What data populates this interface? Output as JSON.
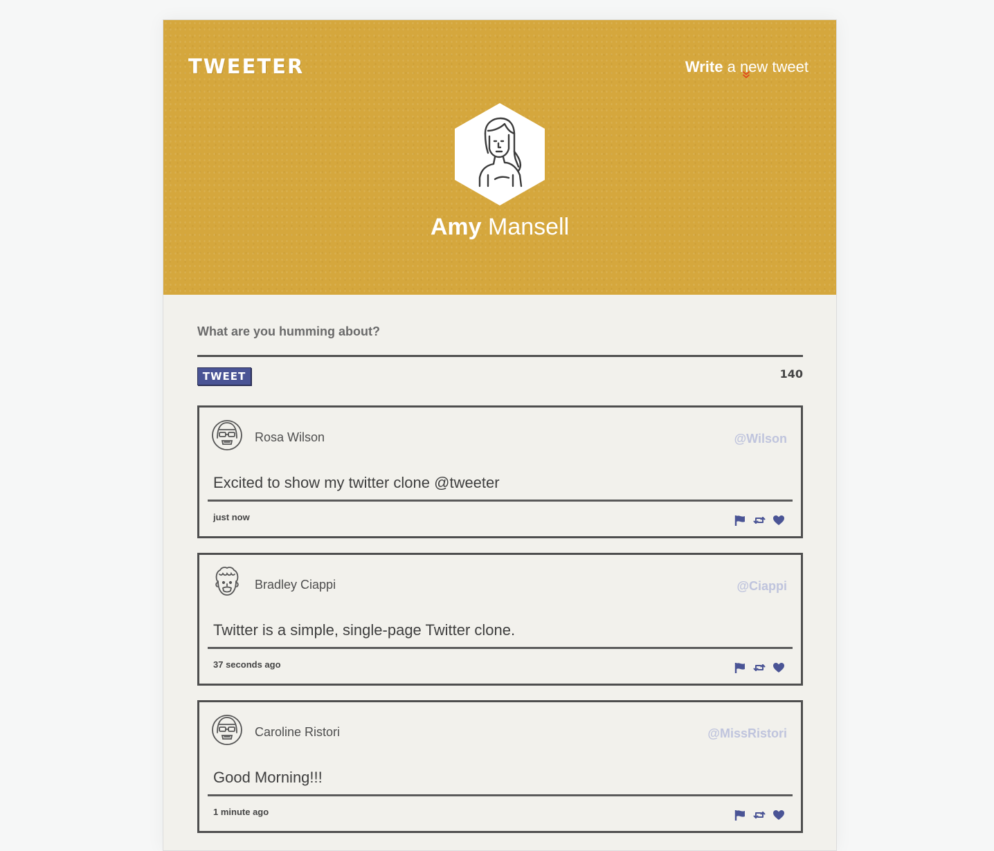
{
  "header": {
    "logo": "TWEETER",
    "compose_toggle": {
      "bold": "Write",
      "rest": " a new tweet"
    },
    "chevron_icon": "double-chevron-down-icon",
    "profile": {
      "first_name": "Amy",
      "last_name": " Mansell",
      "avatar": "hexagon-user-avatar-icon"
    }
  },
  "colors": {
    "header_bg": "#d5a73d",
    "accent": "#4a5495",
    "handle": "#bfc4dd",
    "chevron": "#e2401b"
  },
  "composer": {
    "label": "What are you humming about?",
    "button_label": "TWEET",
    "counter": "140"
  },
  "tweets": [
    {
      "name": "Rosa Wilson",
      "handle": "@Wilson",
      "content": "Excited to show my twitter clone @tweeter",
      "time": "just now",
      "avatar": "woman-glasses-avatar-icon"
    },
    {
      "name": "Bradley Ciappi",
      "handle": "@Ciappi",
      "content": "Twitter is a simple, single-page Twitter clone.",
      "time": "37 seconds ago",
      "avatar": "man-curly-hair-avatar-icon"
    },
    {
      "name": "Caroline Ristori",
      "handle": "@MissRistori",
      "content": "Good Morning!!!",
      "time": "1 minute ago",
      "avatar": "woman-glasses-avatar-icon"
    }
  ],
  "tweet_actions": [
    "flag-icon",
    "retweet-icon",
    "heart-icon"
  ]
}
